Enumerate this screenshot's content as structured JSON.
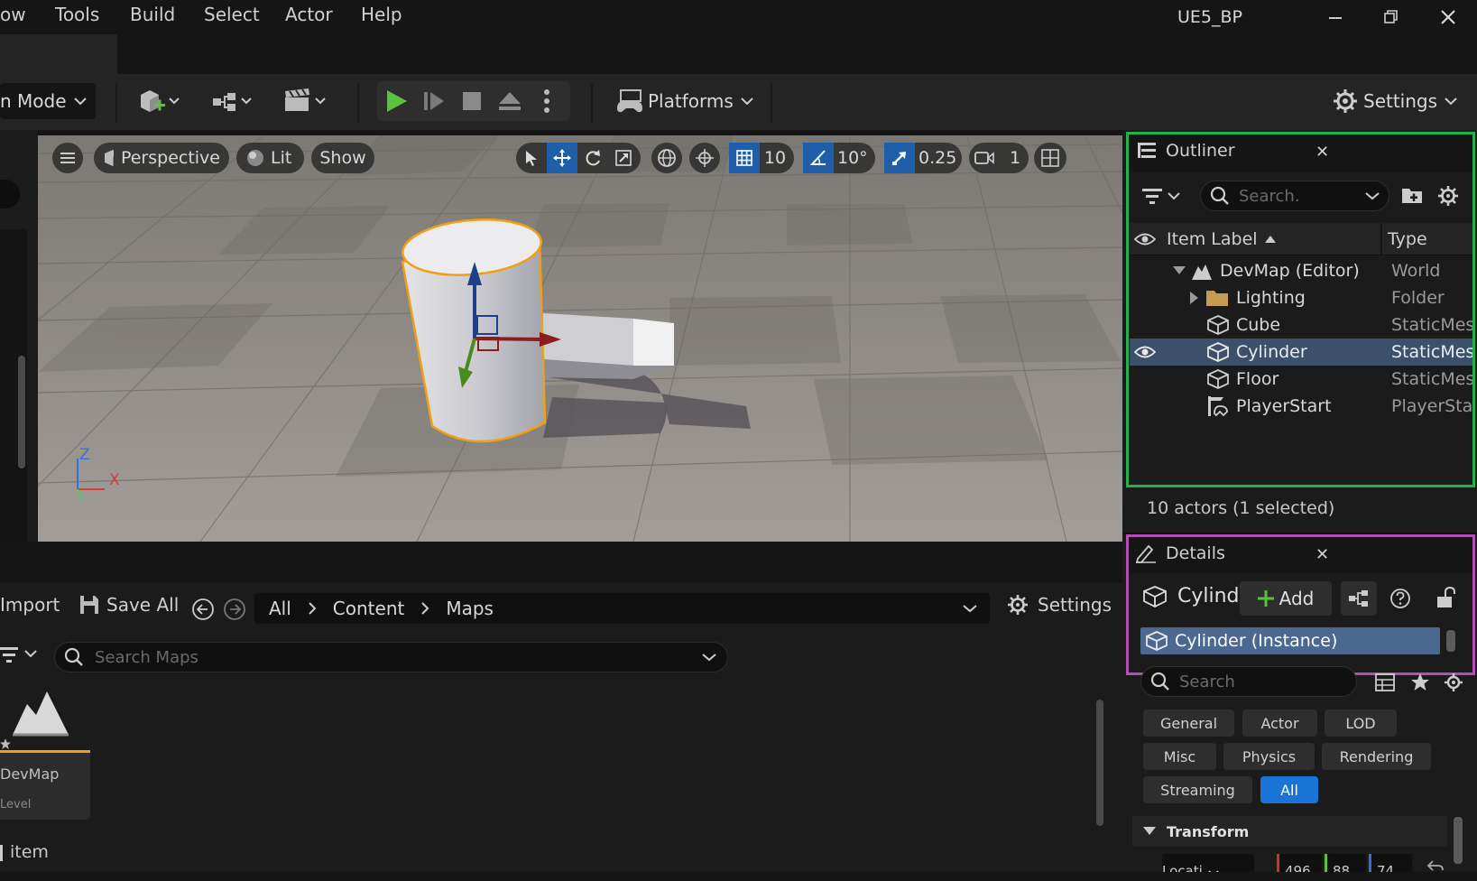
{
  "menu": [
    "ow",
    "Tools",
    "Build",
    "Select",
    "Actor",
    "Help"
  ],
  "project_title": "UE5_BP",
  "toolbar": {
    "mode_label": "n Mode",
    "platforms_label": "Platforms",
    "settings_label": "Settings"
  },
  "viewport": {
    "perspective_label": "Perspective",
    "lit_label": "Lit",
    "show_label": "Show",
    "grid_snap": "10",
    "rotation_snap": "10°",
    "scale_snap": "0.25",
    "camera_speed": "1",
    "axis_z": "Z",
    "axis_x": "X"
  },
  "outliner": {
    "title": "Outliner",
    "search_placeholder": "Search.",
    "col_label": "Item Label",
    "col_type": "Type",
    "items": [
      {
        "label": "DevMap (Editor)",
        "type": "World"
      },
      {
        "label": "Lighting",
        "type": "Folder"
      },
      {
        "label": "Cube",
        "type": "StaticMes"
      },
      {
        "label": "Cylinder",
        "type": "StaticMes"
      },
      {
        "label": "Floor",
        "type": "StaticMes"
      },
      {
        "label": "PlayerStart",
        "type": "PlayerSta"
      }
    ],
    "status": "10 actors (1 selected)"
  },
  "details": {
    "title": "Details",
    "actor_name": "Cylind",
    "add_label": "Add",
    "component": "Cylinder (Instance)",
    "search_placeholder": "Search",
    "categories": [
      "General",
      "Actor",
      "LOD",
      "Misc",
      "Physics",
      "Rendering",
      "Streaming",
      "All"
    ],
    "section": "Transform",
    "location_label": "Locati",
    "loc_x": "496",
    "loc_y": "88",
    "loc_z": "74"
  },
  "content_browser": {
    "import_label": "Import",
    "save_all_label": "Save All",
    "path": [
      "All",
      "Content",
      "Maps"
    ],
    "settings_label": "Settings",
    "search_placeholder": "Search Maps",
    "asset_name": "DevMap",
    "asset_type": "Level",
    "item_count": "item"
  }
}
